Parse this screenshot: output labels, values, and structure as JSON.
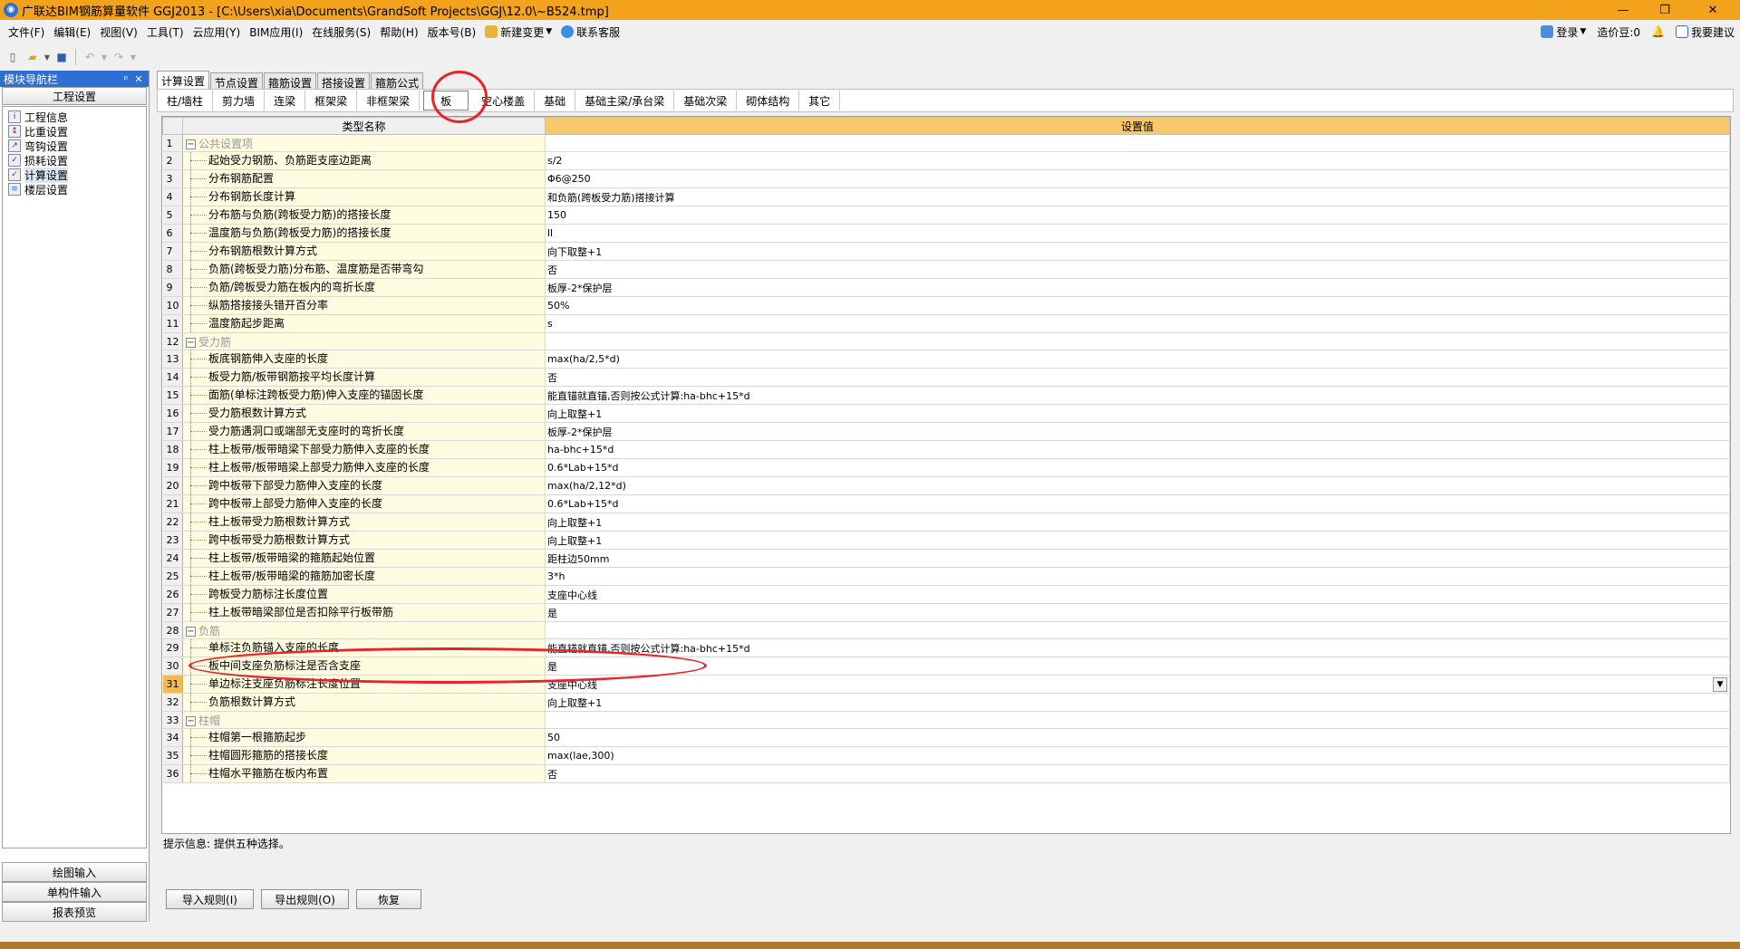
{
  "titlebar": {
    "title": "广联达BIM钢筋算量软件 GGJ2013 - [C:\\Users\\xia\\Documents\\GrandSoft Projects\\GGJ\\12.0\\~B524.tmp]",
    "minimize": "—",
    "restore": "❐",
    "close": "✕"
  },
  "menu": {
    "items": [
      "文件(F)",
      "编辑(E)",
      "视图(V)",
      "工具(T)",
      "云应用(Y)",
      "BIM应用(I)",
      "在线服务(S)",
      "帮助(H)",
      "版本号(B)"
    ],
    "new_change": "新建变更",
    "contact": "联系客服",
    "login": "登录",
    "beans": "造价豆:0",
    "suggest": "我要建议"
  },
  "nav": {
    "header": "模块导航栏",
    "pin": "ᵖ",
    "close": "✕",
    "section": "工程设置",
    "tree": [
      {
        "label": "工程信息",
        "icon": "project-info-icon"
      },
      {
        "label": "比重设置",
        "icon": "density-icon"
      },
      {
        "label": "弯钩设置",
        "icon": "hook-icon"
      },
      {
        "label": "损耗设置",
        "icon": "loss-icon"
      },
      {
        "label": "计算设置",
        "icon": "calc-icon"
      },
      {
        "label": "楼层设置",
        "icon": "floor-icon"
      }
    ],
    "bottom": [
      "绘图输入",
      "单构件输入",
      "报表预览"
    ]
  },
  "tabs1": [
    "计算设置",
    "节点设置",
    "箍筋设置",
    "搭接设置",
    "箍筋公式"
  ],
  "tabs2": [
    "柱/墙柱",
    "剪力墙",
    "连梁",
    "框架梁",
    "非框架梁",
    "板",
    "空心楼盖",
    "基础",
    "基础主梁/承台梁",
    "基础次梁",
    "砌体结构",
    "其它"
  ],
  "grid": {
    "col_name": "类型名称",
    "col_value": "设置值",
    "rows": [
      {
        "n": "1",
        "name": "公共设置项",
        "value": "",
        "cat": true
      },
      {
        "n": "2",
        "name": "起始受力钢筋、负筋距支座边距离",
        "value": "s/2"
      },
      {
        "n": "3",
        "name": "分布钢筋配置",
        "value": "Φ6@250"
      },
      {
        "n": "4",
        "name": "分布钢筋长度计算",
        "value": "和负筋(跨板受力筋)搭接计算"
      },
      {
        "n": "5",
        "name": "分布筋与负筋(跨板受力筋)的搭接长度",
        "value": "150"
      },
      {
        "n": "6",
        "name": "温度筋与负筋(跨板受力筋)的搭接长度",
        "value": "ll"
      },
      {
        "n": "7",
        "name": "分布钢筋根数计算方式",
        "value": "向下取整+1"
      },
      {
        "n": "8",
        "name": "负筋(跨板受力筋)分布筋、温度筋是否带弯勾",
        "value": "否"
      },
      {
        "n": "9",
        "name": "负筋/跨板受力筋在板内的弯折长度",
        "value": "板厚-2*保护层"
      },
      {
        "n": "10",
        "name": "纵筋搭接接头错开百分率",
        "value": "50%"
      },
      {
        "n": "11",
        "name": "温度筋起步距离",
        "value": "s"
      },
      {
        "n": "12",
        "name": "受力筋",
        "value": "",
        "cat": true
      },
      {
        "n": "13",
        "name": "板底钢筋伸入支座的长度",
        "value": "max(ha/2,5*d)"
      },
      {
        "n": "14",
        "name": "板受力筋/板带钢筋按平均长度计算",
        "value": "否"
      },
      {
        "n": "15",
        "name": "面筋(单标注跨板受力筋)伸入支座的锚固长度",
        "value": "能直锚就直锚,否则按公式计算:ha-bhc+15*d"
      },
      {
        "n": "16",
        "name": "受力筋根数计算方式",
        "value": "向上取整+1"
      },
      {
        "n": "17",
        "name": "受力筋遇洞口或端部无支座时的弯折长度",
        "value": "板厚-2*保护层"
      },
      {
        "n": "18",
        "name": "柱上板带/板带暗梁下部受力筋伸入支座的长度",
        "value": "ha-bhc+15*d"
      },
      {
        "n": "19",
        "name": "柱上板带/板带暗梁上部受力筋伸入支座的长度",
        "value": "0.6*Lab+15*d"
      },
      {
        "n": "20",
        "name": "跨中板带下部受力筋伸入支座的长度",
        "value": "max(ha/2,12*d)"
      },
      {
        "n": "21",
        "name": "跨中板带上部受力筋伸入支座的长度",
        "value": "0.6*Lab+15*d"
      },
      {
        "n": "22",
        "name": "柱上板带受力筋根数计算方式",
        "value": "向上取整+1"
      },
      {
        "n": "23",
        "name": "跨中板带受力筋根数计算方式",
        "value": "向上取整+1"
      },
      {
        "n": "24",
        "name": "柱上板带/板带暗梁的箍筋起始位置",
        "value": "距柱边50mm"
      },
      {
        "n": "25",
        "name": "柱上板带/板带暗梁的箍筋加密长度",
        "value": "3*h"
      },
      {
        "n": "26",
        "name": "跨板受力筋标注长度位置",
        "value": "支座中心线"
      },
      {
        "n": "27",
        "name": "柱上板带暗梁部位是否扣除平行板带筋",
        "value": "是"
      },
      {
        "n": "28",
        "name": "负筋",
        "value": "",
        "cat": true
      },
      {
        "n": "29",
        "name": "单标注负筋锚入支座的长度",
        "value": "能直锚就直锚,否则按公式计算:ha-bhc+15*d"
      },
      {
        "n": "30",
        "name": "板中间支座负筋标注是否含支座",
        "value": "是"
      },
      {
        "n": "31",
        "name": "单边标注支座负筋标注长度位置",
        "value": "支座中心线",
        "sel": true
      },
      {
        "n": "32",
        "name": "负筋根数计算方式",
        "value": "向上取整+1"
      },
      {
        "n": "33",
        "name": "柱帽",
        "value": "",
        "cat": true
      },
      {
        "n": "34",
        "name": "柱帽第一根箍筋起步",
        "value": "50"
      },
      {
        "n": "35",
        "name": "柱帽圆形箍筋的搭接长度",
        "value": "max(lae,300)"
      },
      {
        "n": "36",
        "name": "柱帽水平箍筋在板内布置",
        "value": "否"
      }
    ]
  },
  "hint": "提示信息: 提供五种选择。",
  "buttons": {
    "import": "导入规则(I)",
    "export": "导出规则(O)",
    "restore": "恢复"
  },
  "colors": {
    "titlebar": "#f3a21c",
    "nav_header": "#2d6fd4",
    "value_header": "#f7c96b",
    "name_cell": "#fdfce0",
    "annotation": "#e8242b"
  }
}
